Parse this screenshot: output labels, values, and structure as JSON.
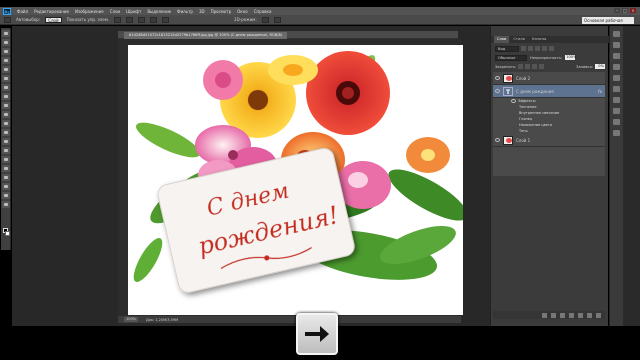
{
  "menubar": {
    "logo": "Ps",
    "items": [
      "Файл",
      "Редактирование",
      "Изображение",
      "Слои",
      "Шрифт",
      "Выделение",
      "Фильтр",
      "3D",
      "Просмотр",
      "Окно",
      "Справка"
    ]
  },
  "window_controls": {
    "minimize": "–",
    "restore": "□",
    "close": "×"
  },
  "options_bar": {
    "autoselect_label": "Автовыбор:",
    "autoselect_value": "Слой",
    "show_controls_label": "Показать упр. элем.",
    "mode_3d_label": "3D-режим:",
    "workspace_select": "Основная рабочая среда"
  },
  "document": {
    "tab_title": "61424Bd51072c1815215d2279b1766ff.jpg.jpg @ 100% (С днем рождения!, RGB/8)",
    "zoom": "100%",
    "doc_info": "Док: 1,20M/3,59M"
  },
  "card": {
    "line1": "С днем",
    "line2": "рождения!"
  },
  "layers_panel": {
    "tabs": [
      "Слои",
      "Стили",
      "Каналы"
    ],
    "kind_label": "Вид",
    "blend_mode": "Обычные",
    "opacity_label": "Непрозрачность:",
    "opacity_value": "100%",
    "lock_label": "Закрепить:",
    "fill_label": "Заливка:",
    "fill_value": "0%",
    "layers": [
      {
        "name": "Слой 2"
      },
      {
        "name": "С днем рождения"
      },
      {
        "name": "Слой 1"
      }
    ],
    "effects_label": "Эффекты",
    "effects": [
      "Тиснение",
      "Внутреннее свечение",
      "Глянец",
      "Наложение цвета",
      "Тень"
    ],
    "fx": "fx"
  },
  "colors": {
    "card_text": "#c62a1c",
    "selected_layer": "#5d7390"
  }
}
